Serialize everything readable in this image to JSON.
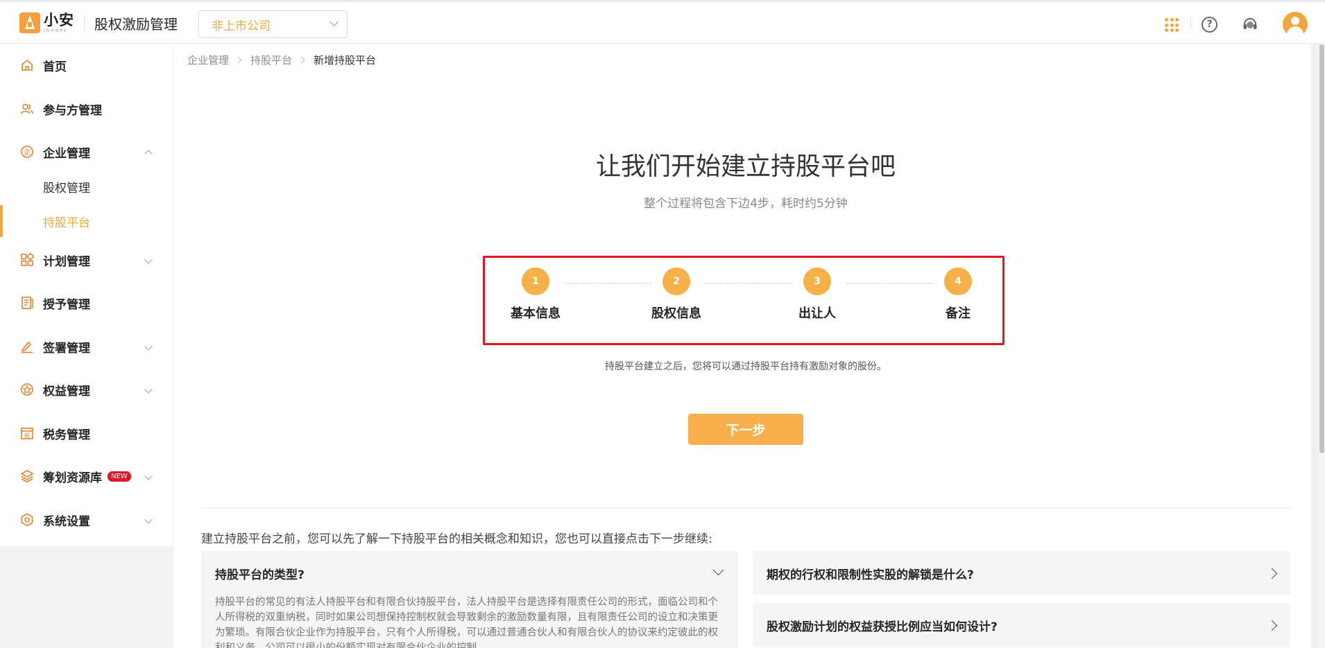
{
  "header": {
    "logo_cn": "小安",
    "logo_en": "INHOPE",
    "app_title": "股权激励管理",
    "company_select": "非上市公司"
  },
  "sidebar": {
    "items": [
      {
        "label": "首页"
      },
      {
        "label": "参与方管理"
      },
      {
        "label": "企业管理"
      },
      {
        "label": "股权管理"
      },
      {
        "label": "持股平台"
      },
      {
        "label": "计划管理"
      },
      {
        "label": "授予管理"
      },
      {
        "label": "签署管理"
      },
      {
        "label": "权益管理"
      },
      {
        "label": "税务管理"
      },
      {
        "label": "筹划资源库",
        "badge": "NEW"
      },
      {
        "label": "系统设置"
      }
    ]
  },
  "breadcrumb": [
    "企业管理",
    "持股平台",
    "新增持股平台"
  ],
  "hero": {
    "title": "让我们开始建立持股平台吧",
    "subtitle": "整个过程将包含下边4步，耗时约5分钟"
  },
  "steps": [
    {
      "num": "1",
      "name": "基本信息"
    },
    {
      "num": "2",
      "name": "股权信息"
    },
    {
      "num": "3",
      "name": "出让人"
    },
    {
      "num": "4",
      "name": "备注"
    }
  ],
  "hint": "持股平台建立之后，您将可以通过持股平台持有激励对象的股份。",
  "next_button": "下一步",
  "faq": {
    "intro": "建立持股平台之前，您可以先了解一下持股平台的相关概念和知识，您也可以直接点击下一步继续:",
    "items": [
      {
        "question": "持股平台的类型?",
        "answer": "持股平台的常见的有法人持股平台和有限合伙持股平台，法人持股平台是选择有限责任公司的形式，面临公司和个人所得税的双重纳税，同时如果公司想保持控制权就会导致剩余的激励数量有限，且有限责任公司的设立和决策更为繁琐。有限合伙企业作为持股平台，只有个人所得税，可以通过普通合伙人和有限合伙人的协议来约定彼此的权利和义务，公司可以很小的份额实现对有限合伙企业的控制。"
      },
      {
        "question": "期权的行权和限制性实股的解锁是什么?"
      },
      {
        "question": "股权激励计划的权益获授比例应当如何设计?"
      }
    ]
  },
  "colors": {
    "accent": "#f3a83a",
    "step_circle": "#f5b048",
    "highlight_border": "#e8141d",
    "badge": "#d9182a"
  }
}
